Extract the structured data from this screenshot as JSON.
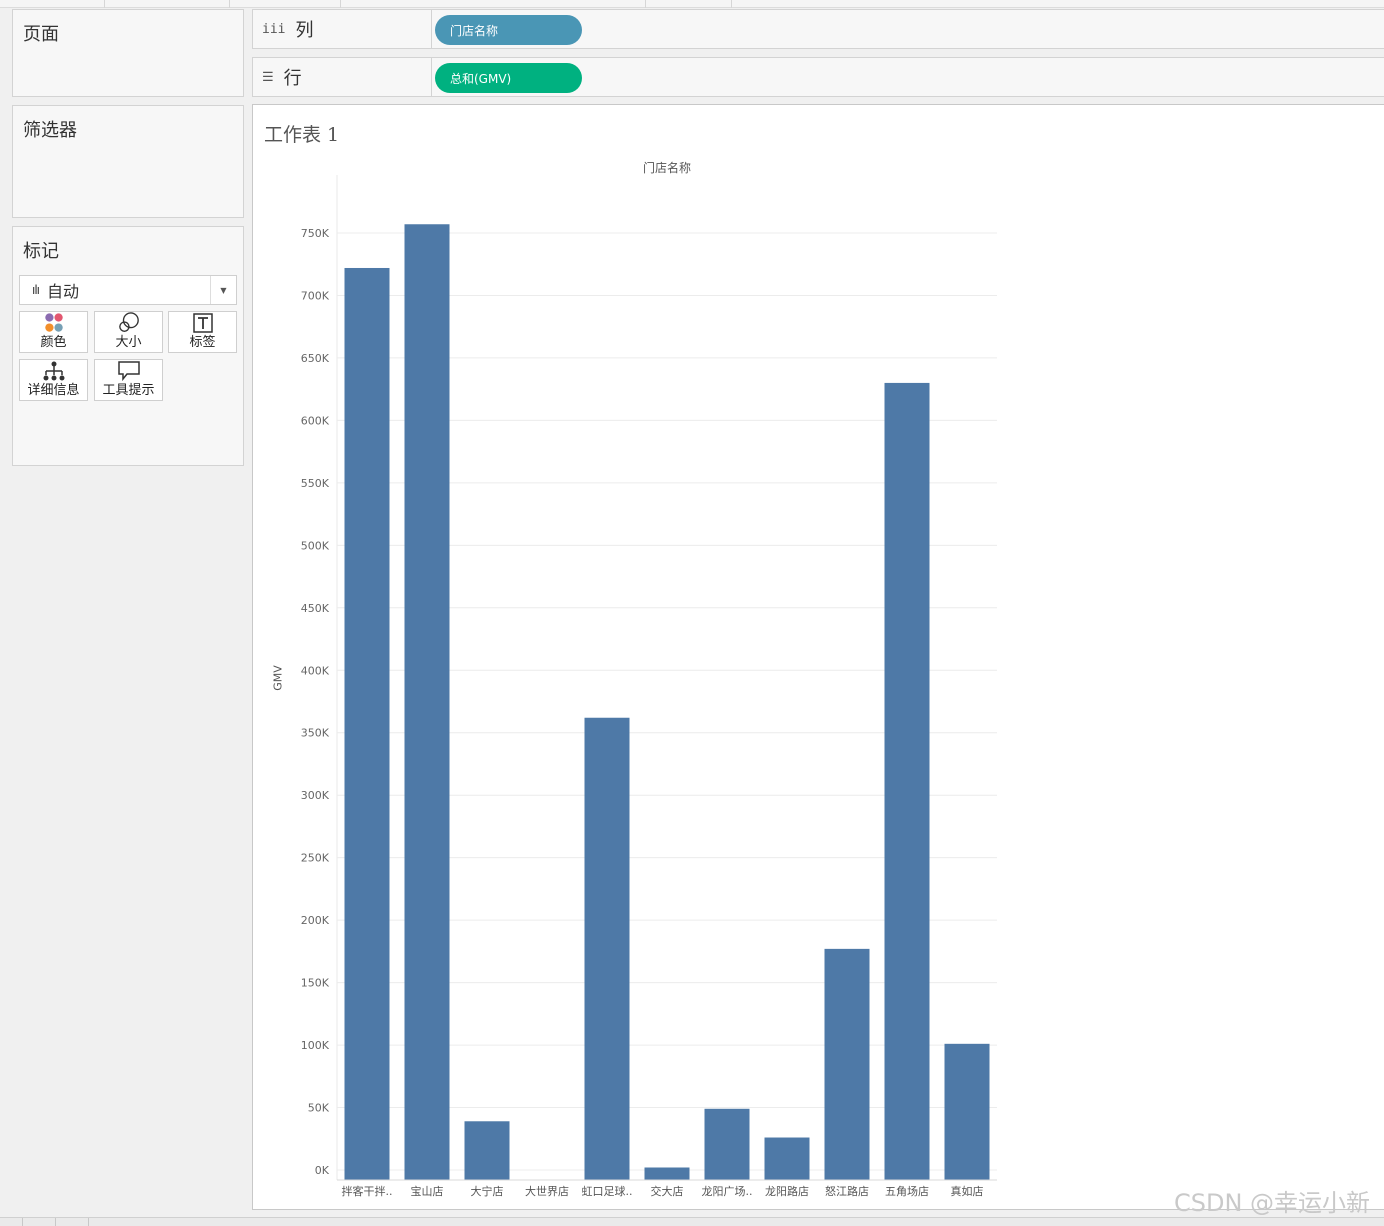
{
  "panels": {
    "pages": {
      "title": "页面"
    },
    "filters": {
      "title": "筛选器"
    },
    "marks": {
      "title": "标记",
      "type": "自动",
      "cards": [
        {
          "label": "颜色",
          "icon": "color-dots-icon"
        },
        {
          "label": "大小",
          "icon": "size-circles-icon"
        },
        {
          "label": "标签",
          "icon": "text-label-icon"
        },
        {
          "label": "详细信息",
          "icon": "detail-hierarchy-icon"
        },
        {
          "label": "工具提示",
          "icon": "tooltip-bubble-icon"
        }
      ]
    }
  },
  "shelves": {
    "columns": {
      "label": "列",
      "pill": "门店名称",
      "pill_color": "#4a96b5"
    },
    "rows": {
      "label": "行",
      "pill": "总和(GMV)",
      "pill_color": "#00b180"
    }
  },
  "sheet": {
    "title": "工作表 1"
  },
  "chart_data": {
    "type": "bar",
    "title": "门店名称",
    "ylabel": "GMV",
    "xlabel": "",
    "categories": [
      "拌客干拌..",
      "宝山店",
      "大宁店",
      "大世界店",
      "虹口足球..",
      "交大店",
      "龙阳广场..",
      "龙阳路店",
      "怒江路店",
      "五角场店",
      "真如店"
    ],
    "values": [
      722000,
      757000,
      39000,
      0,
      362000,
      2000,
      49000,
      26000,
      177000,
      630000,
      101000
    ],
    "ylim": [
      0,
      750000
    ],
    "yticks": [
      0,
      50000,
      100000,
      150000,
      200000,
      250000,
      300000,
      350000,
      400000,
      450000,
      500000,
      550000,
      600000,
      650000,
      700000,
      750000
    ],
    "ytick_labels": [
      "0K",
      "50K",
      "100K",
      "150K",
      "200K",
      "250K",
      "300K",
      "350K",
      "400K",
      "450K",
      "500K",
      "550K",
      "600K",
      "650K",
      "700K",
      "750K"
    ],
    "bar_color": "#4e79a7",
    "grid": true
  },
  "watermark": "CSDN @幸运小新"
}
